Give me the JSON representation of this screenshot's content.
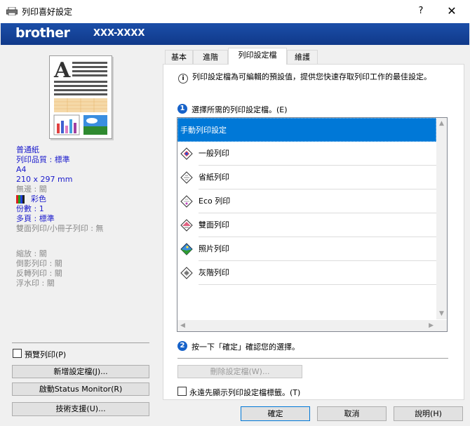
{
  "window": {
    "title": "列印喜好設定",
    "help_label": "?",
    "close_label": "✕"
  },
  "header": {
    "brand": "brother",
    "model": "XXX-XXXX"
  },
  "left_panel": {
    "settings": [
      {
        "text": "普通紙",
        "style": "blue"
      },
      {
        "text": "列印品質 : 標準",
        "style": "blue"
      },
      {
        "text": "A4",
        "style": "blue"
      },
      {
        "text": "210 x 297 mm",
        "style": "blue"
      },
      {
        "text": "無邊 : 關",
        "style": "gray"
      },
      {
        "text": "彩色",
        "style": "blue"
      },
      {
        "text": "份數 : 1",
        "style": "blue"
      },
      {
        "text": "多頁 : 標準",
        "style": "blue"
      },
      {
        "text": "雙面列印/小冊子列印 : 無",
        "style": "gray"
      },
      {
        "text": "縮放 : 關",
        "style": "gray"
      },
      {
        "text": "倒影列印 : 關",
        "style": "gray"
      },
      {
        "text": "反轉列印 : 關",
        "style": "gray"
      },
      {
        "text": "浮水印 : 關",
        "style": "gray"
      }
    ],
    "preview_label": "預覽列印(P)",
    "add_profile_button": "新增設定檔(J)...",
    "status_monitor_button": "啟動Status Monitor(R)",
    "support_button": "技術支援(U)..."
  },
  "tabs": [
    {
      "label": "基本",
      "active": false
    },
    {
      "label": "進階",
      "active": false
    },
    {
      "label": "列印設定檔",
      "active": true
    },
    {
      "label": "維護",
      "active": false
    }
  ],
  "profiles_tab": {
    "description": "列印設定檔為可編輯的預設值，提供您快速存取列印工作的最佳設定。",
    "step1_number": "1",
    "step1_label": "選擇所需的列印設定檔。(E)",
    "items": [
      {
        "label": "手動列印設定",
        "icon": "none",
        "selected": true
      },
      {
        "label": "一般列印",
        "icon": "general-print-icon",
        "selected": false
      },
      {
        "label": "省紙列印",
        "icon": "paper-save-icon",
        "selected": false
      },
      {
        "label": "Eco 列印",
        "icon": "eco-print-icon",
        "selected": false
      },
      {
        "label": "雙面列印",
        "icon": "duplex-print-icon",
        "selected": false
      },
      {
        "label": "照片列印",
        "icon": "photo-print-icon",
        "selected": false
      },
      {
        "label": "灰階列印",
        "icon": "grayscale-print-icon",
        "selected": false
      }
    ],
    "step2_number": "2",
    "step2_label": "按一下「確定」確認您的選擇。",
    "delete_button": "刪除設定檔(W)...",
    "always_show_label": "永遠先顯示列印設定檔標籤。(T)"
  },
  "footer": {
    "ok_button": "確定",
    "cancel_button": "取消",
    "help_button": "說明(H)"
  },
  "colors": {
    "brand_blue": "#1b4ea8",
    "selection_blue": "#0078d7",
    "info_blue": "#1a1acc"
  }
}
